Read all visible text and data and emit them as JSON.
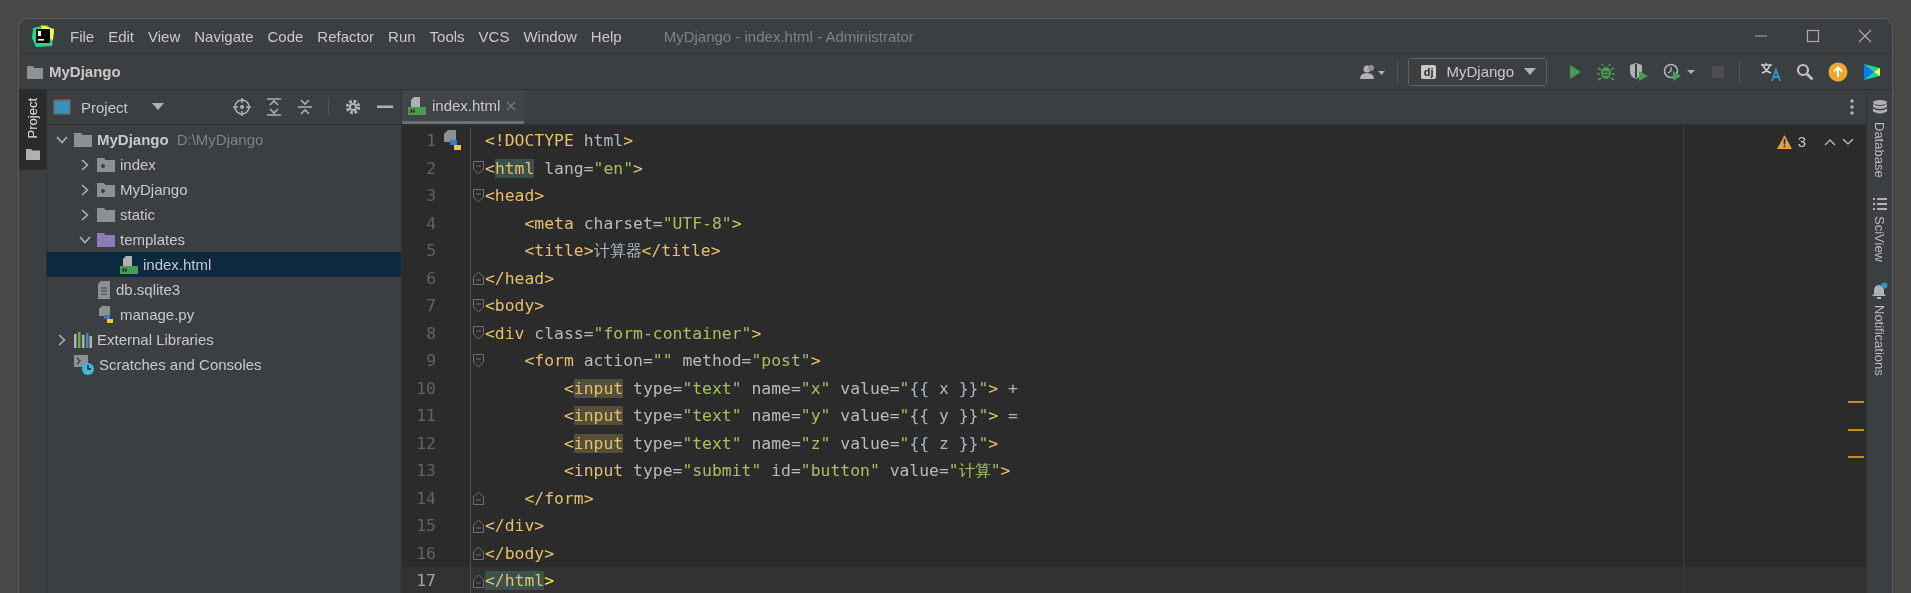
{
  "window": {
    "title": "MyDjango - index.html - Administrator"
  },
  "menu": [
    "File",
    "Edit",
    "View",
    "Navigate",
    "Code",
    "Refactor",
    "Run",
    "Tools",
    "VCS",
    "Window",
    "Help"
  ],
  "navbar": {
    "project": "MyDjango",
    "account_tools": [
      {
        "kind": "user",
        "disabled": false
      }
    ],
    "run_config": {
      "badge": "dj",
      "label": "MyDjango"
    },
    "run_tools": [
      {
        "kind": "run",
        "disabled": false
      },
      {
        "kind": "debug",
        "disabled": false
      },
      {
        "kind": "coverage",
        "disabled": false
      },
      {
        "kind": "profile",
        "disabled": false
      },
      {
        "kind": "stop",
        "disabled": true
      }
    ],
    "extra_tools": [
      {
        "kind": "translate",
        "disabled": false
      },
      {
        "kind": "search",
        "disabled": false
      },
      {
        "kind": "update",
        "disabled": false
      },
      {
        "kind": "logo",
        "disabled": false
      }
    ]
  },
  "left_stripe": [
    {
      "label": "Project",
      "selected": true
    }
  ],
  "right_stripe": [
    {
      "label": "Database",
      "kind": "database"
    },
    {
      "label": "SciView",
      "kind": "sciview"
    },
    {
      "label": "Notifications",
      "kind": "notifications"
    }
  ],
  "project_panel": {
    "title": "Project",
    "tree": [
      {
        "name": "MyDjango",
        "path": "D:\\MyDjango",
        "kind": "folder",
        "expanded": true,
        "selected": false,
        "children": [
          {
            "name": "index",
            "kind": "package",
            "expanded": false,
            "selected": false
          },
          {
            "name": "MyDjango",
            "kind": "package",
            "expanded": false,
            "selected": false
          },
          {
            "name": "static",
            "kind": "folder",
            "expanded": false,
            "selected": false
          },
          {
            "name": "templates",
            "kind": "template_folder",
            "expanded": true,
            "selected": false,
            "children": [
              {
                "name": "index.html",
                "kind": "html",
                "selected": true
              }
            ]
          },
          {
            "name": "db.sqlite3",
            "kind": "file",
            "selected": false
          },
          {
            "name": "manage.py",
            "kind": "python",
            "selected": false
          }
        ]
      },
      {
        "name": "External Libraries",
        "kind": "libraries",
        "expanded": false,
        "selected": false
      },
      {
        "name": "Scratches and Consoles",
        "kind": "scratches",
        "selected": false
      }
    ]
  },
  "editor": {
    "tabs": [
      {
        "label": "index.html",
        "selected": true
      }
    ],
    "warnings": "3",
    "lines": [
      {
        "number": "1",
        "kind": "python_gutter",
        "current": false,
        "warning": false,
        "tokens": [
          {
            "kind": "tag",
            "text": "<!DOCTYPE"
          },
          {
            "kind": "text",
            "text": " html"
          },
          {
            "kind": "tag",
            "text": ">"
          }
        ]
      },
      {
        "number": "2",
        "kind": "fold_start",
        "current": false,
        "warning": false,
        "tokens": [
          {
            "kind": "tag",
            "text": "<"
          },
          {
            "kind": "tag_match",
            "text": "html"
          },
          {
            "kind": "attr",
            "text": " lang="
          },
          {
            "kind": "value",
            "text": "\"en\""
          },
          {
            "kind": "tag",
            "text": ">"
          }
        ]
      },
      {
        "number": "3",
        "kind": "fold_start",
        "current": false,
        "warning": false,
        "tokens": [
          {
            "kind": "tag",
            "text": "<head>"
          }
        ]
      },
      {
        "number": "4",
        "kind": "plain",
        "current": false,
        "warning": false,
        "tokens": [
          {
            "kind": "tag",
            "text": "    <meta"
          },
          {
            "kind": "attr",
            "text": " charset="
          },
          {
            "kind": "value",
            "text": "\"UTF-8\""
          },
          {
            "kind": "tag",
            "text": ">"
          }
        ]
      },
      {
        "number": "5",
        "kind": "plain",
        "current": false,
        "warning": false,
        "tokens": [
          {
            "kind": "tag",
            "text": "    <title>"
          },
          {
            "kind": "text",
            "text": "计算器"
          },
          {
            "kind": "tag",
            "text": "</title>"
          }
        ]
      },
      {
        "number": "6",
        "kind": "fold_end",
        "current": false,
        "warning": false,
        "tokens": [
          {
            "kind": "tag",
            "text": "</head>"
          }
        ]
      },
      {
        "number": "7",
        "kind": "fold_start",
        "current": false,
        "warning": false,
        "tokens": [
          {
            "kind": "tag",
            "text": "<body>"
          }
        ]
      },
      {
        "number": "8",
        "kind": "fold_start",
        "current": false,
        "warning": false,
        "tokens": [
          {
            "kind": "tag",
            "text": "<div"
          },
          {
            "kind": "attr",
            "text": " class="
          },
          {
            "kind": "value",
            "text": "\"form-container\""
          },
          {
            "kind": "tag",
            "text": ">"
          }
        ]
      },
      {
        "number": "9",
        "kind": "fold_start",
        "current": false,
        "warning": false,
        "tokens": [
          {
            "kind": "tag",
            "text": "    <form"
          },
          {
            "kind": "attr",
            "text": " action="
          },
          {
            "kind": "value",
            "text": "\"\""
          },
          {
            "kind": "attr",
            "text": " method="
          },
          {
            "kind": "value",
            "text": "\"post\""
          },
          {
            "kind": "tag",
            "text": ">"
          }
        ]
      },
      {
        "number": "10",
        "kind": "plain",
        "current": false,
        "warning": true,
        "tokens": [
          {
            "kind": "tag",
            "text": "        <"
          },
          {
            "kind": "tag_ref",
            "text": "input"
          },
          {
            "kind": "attr",
            "text": " type="
          },
          {
            "kind": "value",
            "text": "\"text\""
          },
          {
            "kind": "attr",
            "text": " name="
          },
          {
            "kind": "value",
            "text": "\"x\""
          },
          {
            "kind": "attr",
            "text": " value="
          },
          {
            "kind": "value",
            "text": "\""
          },
          {
            "kind": "text",
            "text": "{{ x }}"
          },
          {
            "kind": "value",
            "text": "\""
          },
          {
            "kind": "tag",
            "text": ">"
          },
          {
            "kind": "text",
            "text": " +"
          }
        ]
      },
      {
        "number": "11",
        "kind": "plain",
        "current": false,
        "warning": true,
        "tokens": [
          {
            "kind": "tag",
            "text": "        <"
          },
          {
            "kind": "tag_ref",
            "text": "input"
          },
          {
            "kind": "attr",
            "text": " type="
          },
          {
            "kind": "value",
            "text": "\"text\""
          },
          {
            "kind": "attr",
            "text": " name="
          },
          {
            "kind": "value",
            "text": "\"y\""
          },
          {
            "kind": "attr",
            "text": " value="
          },
          {
            "kind": "value",
            "text": "\""
          },
          {
            "kind": "text",
            "text": "{{ y }}"
          },
          {
            "kind": "value",
            "text": "\""
          },
          {
            "kind": "tag",
            "text": ">"
          },
          {
            "kind": "text",
            "text": " ="
          }
        ]
      },
      {
        "number": "12",
        "kind": "plain",
        "current": false,
        "warning": true,
        "tokens": [
          {
            "kind": "tag",
            "text": "        <"
          },
          {
            "kind": "tag_ref",
            "text": "input"
          },
          {
            "kind": "attr",
            "text": " type="
          },
          {
            "kind": "value",
            "text": "\"text\""
          },
          {
            "kind": "attr",
            "text": " name="
          },
          {
            "kind": "value",
            "text": "\"z\""
          },
          {
            "kind": "attr",
            "text": " value="
          },
          {
            "kind": "value",
            "text": "\""
          },
          {
            "kind": "text",
            "text": "{{ z }}"
          },
          {
            "kind": "value",
            "text": "\""
          },
          {
            "kind": "tag",
            "text": ">"
          }
        ]
      },
      {
        "number": "13",
        "kind": "plain",
        "current": false,
        "warning": false,
        "tokens": [
          {
            "kind": "tag",
            "text": "        <input"
          },
          {
            "kind": "attr",
            "text": " type="
          },
          {
            "kind": "value",
            "text": "\"submit\""
          },
          {
            "kind": "attr",
            "text": " id="
          },
          {
            "kind": "value",
            "text": "\"button\""
          },
          {
            "kind": "attr",
            "text": " value="
          },
          {
            "kind": "value",
            "text": "\"计算\""
          },
          {
            "kind": "tag",
            "text": ">"
          }
        ]
      },
      {
        "number": "14",
        "kind": "fold_end",
        "current": false,
        "warning": false,
        "tokens": [
          {
            "kind": "tag",
            "text": "    </form>"
          }
        ]
      },
      {
        "number": "15",
        "kind": "fold_end",
        "current": false,
        "warning": false,
        "tokens": [
          {
            "kind": "tag",
            "text": "</div>"
          }
        ]
      },
      {
        "number": "16",
        "kind": "fold_end",
        "current": false,
        "warning": false,
        "tokens": [
          {
            "kind": "tag",
            "text": "</body>"
          }
        ]
      },
      {
        "number": "17",
        "kind": "fold_end",
        "current": true,
        "warning": false,
        "tokens": [
          {
            "kind": "tag_match",
            "text": "</html"
          },
          {
            "kind": "tag_bright",
            "text": ">"
          }
        ]
      }
    ]
  }
}
